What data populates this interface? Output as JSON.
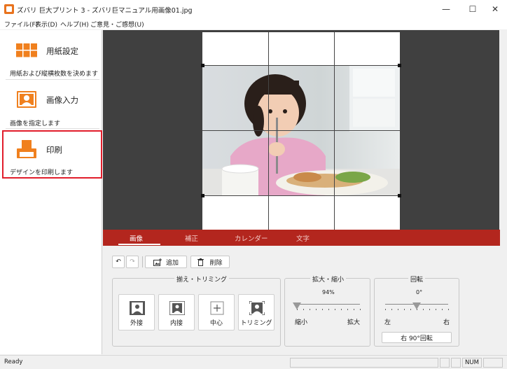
{
  "window": {
    "title": "ズバリ 巨大プリント 3 - ズバリ巨マニュアル用画像01.jpg",
    "minimize": "—",
    "maximize": "☐",
    "close": "✕"
  },
  "menu": [
    "ファイル(F)",
    "表示(D)",
    "ヘルプ(H)",
    "ご意見・ご感想(U)"
  ],
  "sidebar": {
    "paper": {
      "title": "用紙設定",
      "desc": "用紙および縦横枚数を決めます",
      "icon": "grid-icon"
    },
    "image": {
      "title": "画像入力",
      "desc": "画像を指定します",
      "icon": "portrait-icon"
    },
    "print": {
      "title": "印刷",
      "desc": "デザインを印刷します",
      "icon": "printer-icon"
    }
  },
  "tabs": [
    {
      "label": "画像",
      "active": true
    },
    {
      "label": "補正",
      "active": false
    },
    {
      "label": "カレンダー",
      "active": false
    },
    {
      "label": "文字",
      "active": false
    }
  ],
  "toolbar": {
    "undo": "↶",
    "redo": "↷",
    "add_label": "追加",
    "delete_label": "削除"
  },
  "fit_group": {
    "title": "揃え・トリミング",
    "buttons": [
      "外接",
      "内接",
      "中心",
      "トリミング"
    ]
  },
  "zoom_group": {
    "title": "拡大・縮小",
    "value": "94%",
    "min_label": "縮小",
    "max_label": "拡大",
    "level": 0.0
  },
  "rotate_group": {
    "title": "回転",
    "value": "0°",
    "left_label": "左",
    "right_label": "右",
    "rotate_button": "右 90°回転",
    "level": 0.5
  },
  "status": {
    "ready": "Ready",
    "num": "NUM"
  },
  "colors": {
    "accent": "#b3261e",
    "highlight": "#e11d2b",
    "icon_orange": "#f0801e",
    "canvas_bg": "#404040"
  }
}
